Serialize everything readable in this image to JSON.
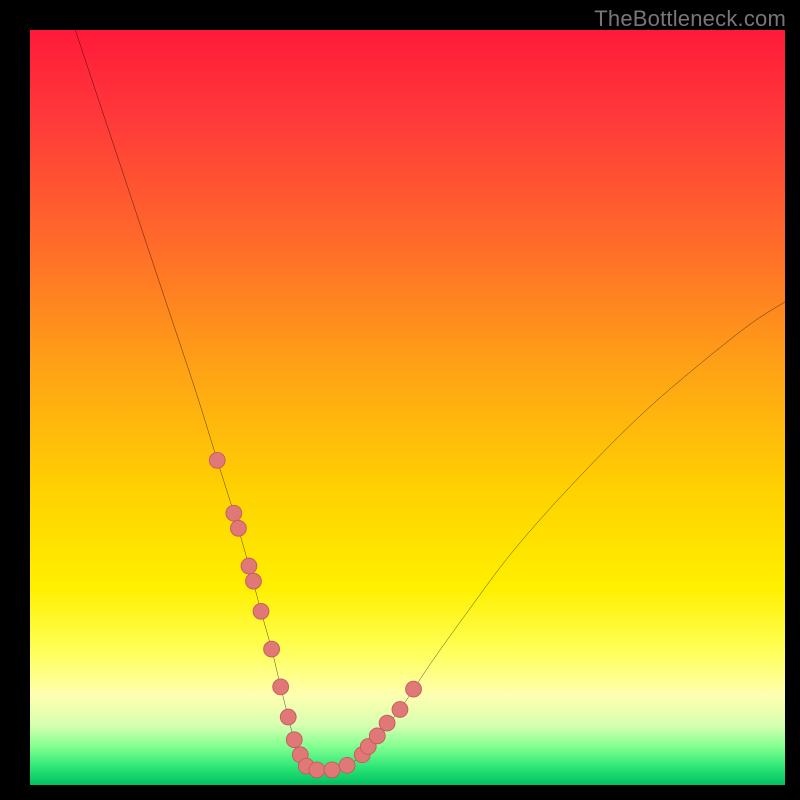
{
  "watermark": {
    "text": "TheBottleneck.com"
  },
  "colors": {
    "background": "#000000",
    "curve": "#000000",
    "marker_fill": "#e07878",
    "marker_stroke": "#c85a5a",
    "gradient_stops": [
      {
        "offset": 0.0,
        "color": "#ff1a3a"
      },
      {
        "offset": 0.12,
        "color": "#ff3a3a"
      },
      {
        "offset": 0.28,
        "color": "#ff6a2a"
      },
      {
        "offset": 0.45,
        "color": "#ffa315"
      },
      {
        "offset": 0.62,
        "color": "#ffd400"
      },
      {
        "offset": 0.74,
        "color": "#fff000"
      },
      {
        "offset": 0.82,
        "color": "#ffff55"
      },
      {
        "offset": 0.88,
        "color": "#ffffb0"
      },
      {
        "offset": 0.92,
        "color": "#d8ffb0"
      },
      {
        "offset": 0.95,
        "color": "#80ff90"
      },
      {
        "offset": 0.975,
        "color": "#30e878"
      },
      {
        "offset": 1.0,
        "color": "#00c060"
      }
    ]
  },
  "chart_data": {
    "type": "line",
    "title": "",
    "xlabel": "",
    "ylabel": "",
    "xlim": [
      0,
      100
    ],
    "ylim": [
      0,
      100
    ],
    "series": [
      {
        "name": "bottleneck-curve",
        "x": [
          6,
          10,
          14,
          18,
          22,
          24.8,
          27,
          29,
          30.6,
          32,
          33.2,
          34.2,
          35,
          35.8,
          36.6,
          38,
          40,
          42,
          44,
          46,
          49,
          53,
          58,
          64,
          72,
          82,
          94,
          100
        ],
        "y": [
          100,
          88,
          76,
          64,
          52,
          43,
          36,
          29,
          23,
          18,
          13,
          9,
          6,
          4,
          2.5,
          2,
          2,
          2.6,
          4,
          6.5,
          10,
          16,
          23,
          31,
          40,
          50,
          60,
          64
        ]
      }
    ],
    "markers": {
      "name": "highlight-dots",
      "x": [
        24.8,
        27.0,
        27.6,
        29.0,
        29.6,
        30.6,
        32.0,
        33.2,
        34.2,
        35.0,
        35.8,
        36.6,
        38.0,
        40.0,
        42.0,
        44.0,
        44.8,
        46.0,
        47.3,
        49.0,
        50.8
      ],
      "y": [
        43.0,
        36.0,
        34.0,
        29.0,
        27.0,
        23.0,
        18.0,
        13.0,
        9.0,
        6.0,
        4.0,
        2.5,
        2.0,
        2.0,
        2.6,
        4.0,
        5.1,
        6.5,
        8.2,
        10.0,
        12.7
      ]
    }
  }
}
